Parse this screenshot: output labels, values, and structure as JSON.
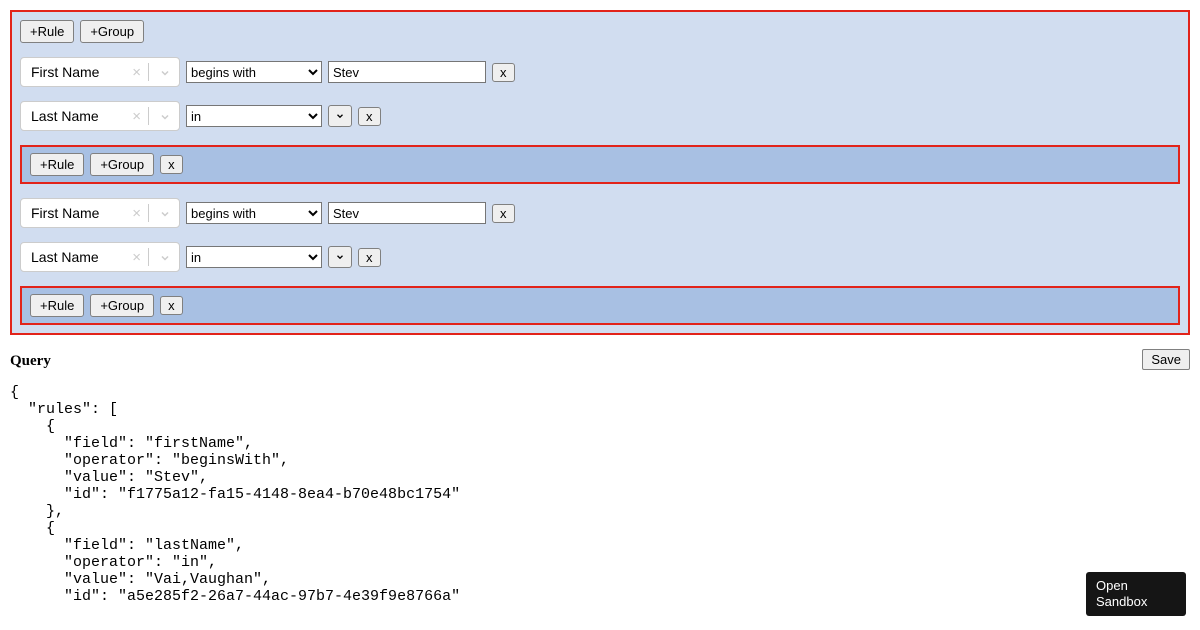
{
  "buttons": {
    "add_rule": "+Rule",
    "add_group": "+Group",
    "remove": "x",
    "save": "Save",
    "open_sandbox": "Open Sandbox"
  },
  "fields": {
    "first_name": "First Name",
    "last_name": "Last Name"
  },
  "operators": {
    "begins_with": "begins with",
    "in": "in"
  },
  "values": {
    "stev": "Stev"
  },
  "query_heading": "Query",
  "query_json": "{\n  \"rules\": [\n    {\n      \"field\": \"firstName\",\n      \"operator\": \"beginsWith\",\n      \"value\": \"Stev\",\n      \"id\": \"f1775a12-fa15-4148-8ea4-b70e48bc1754\"\n    },\n    {\n      \"field\": \"lastName\",\n      \"operator\": \"in\",\n      \"value\": \"Vai,Vaughan\",\n      \"id\": \"a5e285f2-26a7-44ac-97b7-4e39f9e8766a\""
}
